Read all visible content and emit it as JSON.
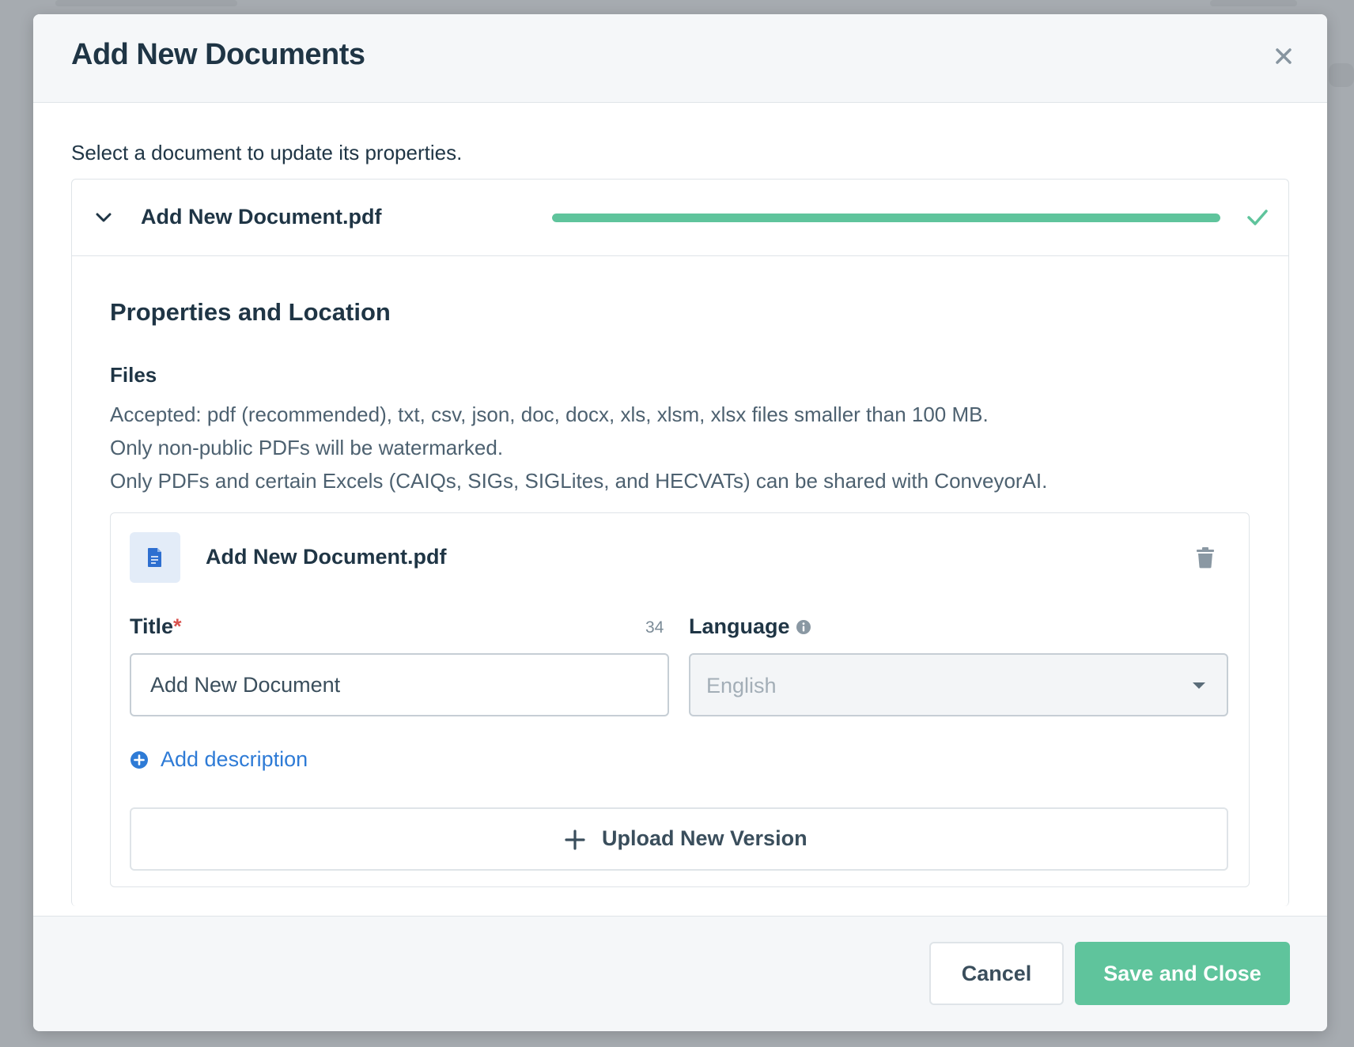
{
  "modal": {
    "title": "Add New Documents",
    "instructions": "Select a document to update its properties."
  },
  "document": {
    "name": "Add New Document.pdf",
    "upload_progress": 1.0,
    "status": "complete",
    "accent_color": "#5fc49c"
  },
  "properties": {
    "section_title": "Properties and Location",
    "files_label": "Files",
    "help_lines": [
      "Accepted: pdf (recommended), txt, csv, json, doc, docx, xls, xlsm, xlsx files smaller than 100 MB.",
      "Only non-public PDFs will be watermarked.",
      "Only PDFs and certain Excels (CAIQs, SIGs, SIGLites, and HECVATs) can be shared with ConveyorAI."
    ]
  },
  "file": {
    "name": "Add New Document.pdf",
    "title_label": "Title",
    "required_marker": "*",
    "title_char_count": "34",
    "title_value": "Add New Document",
    "language_label": "Language",
    "language_value": "English",
    "add_description_label": "Add description",
    "upload_new_version_label": "Upload New Version"
  },
  "footer": {
    "cancel_label": "Cancel",
    "save_label": "Save and Close"
  },
  "colors": {
    "primary_green": "#5fc49c",
    "link_blue": "#2e7bd6",
    "text_dark": "#1f3545",
    "required_red": "#d9534f"
  }
}
